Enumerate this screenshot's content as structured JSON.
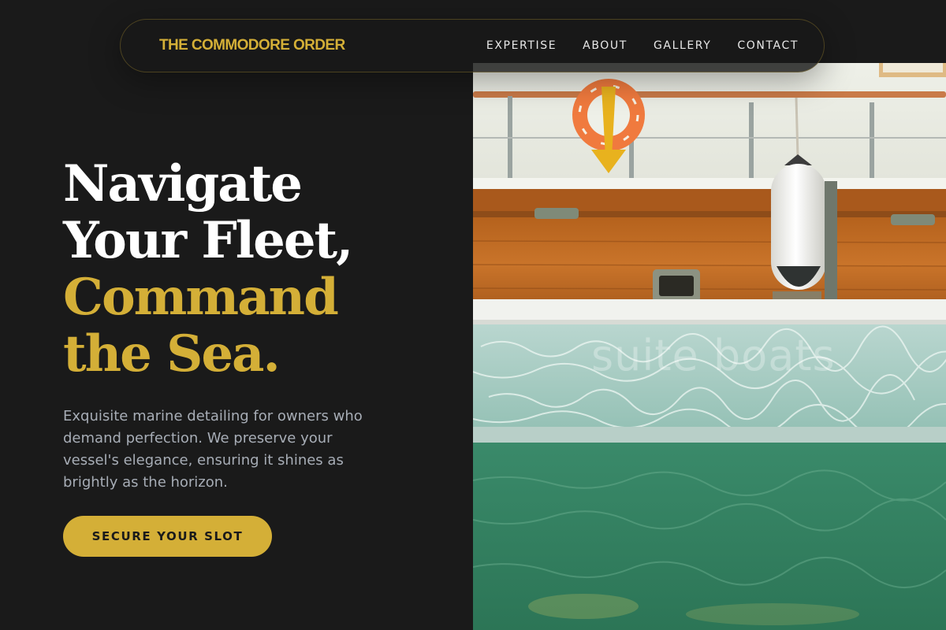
{
  "brand": {
    "name": "THE COMMODORE ORDER"
  },
  "nav": {
    "links": [
      {
        "label": "EXPERTISE"
      },
      {
        "label": "ABOUT"
      },
      {
        "label": "GALLERY"
      },
      {
        "label": "CONTACT"
      }
    ]
  },
  "hero": {
    "headline": {
      "line1": "Navigate",
      "line2": "Your Fleet,",
      "line3": "Command",
      "line4": "the Sea."
    },
    "description": "Exquisite marine detailing for owners who demand perfection. We preserve your vessel's elegance, ensuring it shines as brightly as the horizon.",
    "cta_label": "SECURE YOUR SLOT",
    "image": {
      "subject": "boat-hull-on-water",
      "watermark": "suite boats"
    }
  },
  "colors": {
    "background": "#1a1a1a",
    "accent_gold": "#d4af37",
    "text_white": "#ffffff",
    "text_muted": "#a7adb6"
  }
}
